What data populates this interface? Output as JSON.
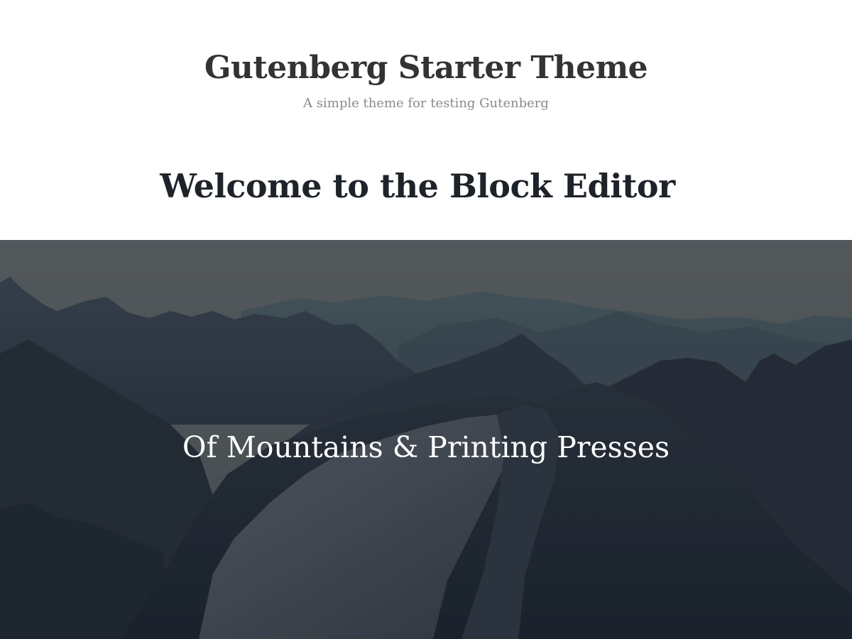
{
  "header": {
    "site_title": "Gutenberg Starter Theme",
    "tagline": "A simple theme for testing Gutenberg"
  },
  "post": {
    "title": "Welcome to the Block Editor"
  },
  "cover": {
    "caption": "Of Mountains & Printing Presses"
  },
  "colors": {
    "title": "#333333",
    "tagline": "#8a8a8a",
    "heading": "#1e2329",
    "cover_overlay": "#1d2530",
    "cover_text": "#ffffff"
  }
}
